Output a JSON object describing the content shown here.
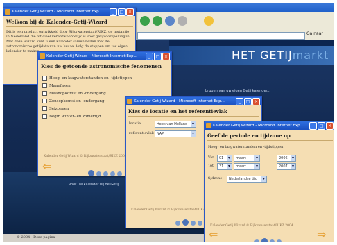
{
  "dialog_title": "Kalender Getij Wizard - Microsoft Internet Exp...",
  "site": {
    "logo_part1": "HET GETIJ",
    "logo_part2": "markt",
    "go_label": "Ga naar",
    "text_block1": "brugen van uw eigen Getij kalender...",
    "text_block2": "Voor uw kalender bij de Getij...",
    "bottom_text": "© 2004 - Deze pagina"
  },
  "welcome": {
    "heading": "Welkom bij de Kalender-Getij-Wizard",
    "paragraph": "Dit is een product ontwikkeld door Rijkswaterstaat/RIKZ, de instantie in Nederland die officieel verantwoordelijk is voor getijvoorspellingen. Met deze wizard kunt u een kalender samenstellen met de astronomische getijdata van uw keuze. Volg de stappen om uw eigen kalender te maken."
  },
  "phenomena": {
    "heading": "Kies de getoonde astronomische fenomenen",
    "options": [
      "Hoog- en laagwaterstanden en -tijdstippen",
      "Maanfasen",
      "Maanopkomst en -ondergang",
      "Zonsopkomst en -ondergang",
      "Seizoenen",
      "Begin winter- en zomertijd"
    ],
    "footer": "Kalender Getij Wizard © Rijkswaterstaat/RIKZ 2004"
  },
  "location": {
    "heading": "Kies de locatie en het referentievlak",
    "location_label": "locatie",
    "location_value": "Hoek van Holland",
    "reference_label": "referentievlak",
    "reference_value": "NAP",
    "footer": "Kalender Getij Wizard © Rijkswaterstaat/RIKZ 2004"
  },
  "period": {
    "heading": "Geef de periode en tijdzone op",
    "section_label": "Hoog- en laagwaterstanden en -tijdstippen",
    "row1": {
      "prefix": "Van",
      "day": "01",
      "month": "maart",
      "year": "2006"
    },
    "row2": {
      "prefix": "Tot",
      "day": "31",
      "month": "maart",
      "year": "2007"
    },
    "timezone_label": "tijdzone",
    "timezone_value": "Nederlandse tijd",
    "footer": "Kalender Getij Wizard © Rijkswaterstaat/RIKZ 2004"
  },
  "colors": {
    "dialog_bg": "#f5deb3",
    "title_blue": "#1b50c0",
    "close_red": "#d9502f"
  }
}
